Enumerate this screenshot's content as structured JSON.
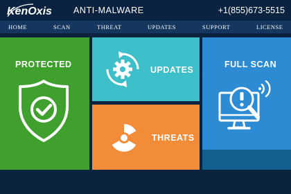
{
  "header": {
    "logo_text": "KenOxis",
    "product": "ANTI-MALWARE",
    "phone": "+1(855)673-5515"
  },
  "nav": [
    {
      "label": "HOME"
    },
    {
      "label": "SCAN"
    },
    {
      "label": "THREAT"
    },
    {
      "label": "UPDATES"
    },
    {
      "label": "SUPPORT"
    },
    {
      "label": "LICENSE"
    }
  ],
  "tiles": {
    "protected": {
      "label": "PROTECTED",
      "icon": "shield-check-icon",
      "color": "#3fa02e"
    },
    "updates": {
      "label": "UPDATES",
      "icon": "gear-sync-icon",
      "color": "#3cbfc8"
    },
    "threats": {
      "label": "THREATS",
      "icon": "radiation-icon",
      "color": "#f28c38"
    },
    "fullscan": {
      "label": "FULL SCAN",
      "icon": "monitor-scan-icon",
      "color": "#2c8bd2"
    }
  },
  "colors": {
    "header_bg": "#0b2341",
    "nav_bg": "#14365f",
    "strip": "#11608e"
  }
}
